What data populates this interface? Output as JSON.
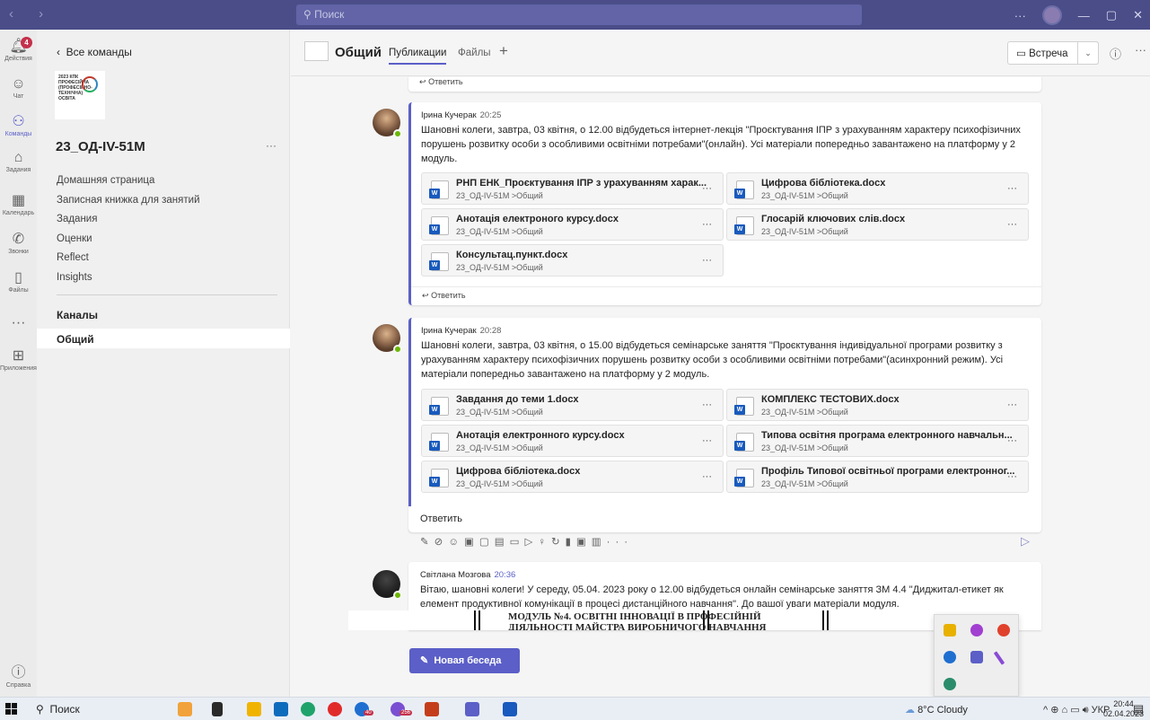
{
  "topbar": {
    "search_placeholder": "Поиск",
    "ellipsis": "···"
  },
  "rail": [
    {
      "label": "Действия",
      "badge": "4"
    },
    {
      "label": "Чат"
    },
    {
      "label": "Команды"
    },
    {
      "label": "Задания"
    },
    {
      "label": "Календарь"
    },
    {
      "label": "Звонки"
    },
    {
      "label": "Файлы"
    },
    {
      "label": "Приложения"
    },
    {
      "label": "Справка"
    }
  ],
  "panel": {
    "back": "Все команды",
    "logo_text": "2023 КПК ПРОФЕСІЙНА (ПРОФЕСІЙНО-ТЕХНІЧНА) ОСВІТА",
    "team_name": "23_ОД-IV-51М",
    "more": "···",
    "links": [
      "Домашняя страница",
      "Записная книжка для занятий",
      "Задания",
      "Оценки",
      "Reflect",
      "Insights"
    ],
    "channels_header": "Каналы",
    "channel": "Общий"
  },
  "header": {
    "title": "Общий",
    "tab_posts": "Публикации",
    "tab_files": "Файлы",
    "add": "+",
    "meet": "Встреча",
    "more": "···"
  },
  "posts": [
    {
      "reply": "Ответить"
    },
    {
      "author": "Ірина Кучерак",
      "time": "20:25",
      "text": "Шановні колеги, завтра, 03 квітня, о 12.00 відбудеться інтернет-лекція \"Проєктування ІПР з урахуванням характеру психофізичних порушень розвитку особи з особливими освітніми потребами\"(онлайн). Усі матеріали попередньо завантажено на платформу у 2 модуль.",
      "files": [
        {
          "name": "РНП ЕНК_Проєктування ІПР з урахуванням харак...",
          "path": "23_ОД-IV-51М >Общий"
        },
        {
          "name": "Цифрова бібліотека.docx",
          "path": "23_ОД-IV-51М >Общий"
        },
        {
          "name": "Анотація електроного курсу.docx",
          "path": "23_ОД-IV-51М >Общий"
        },
        {
          "name": "Глосарій ключових слів.docx",
          "path": "23_ОД-IV-51М >Общий"
        },
        {
          "name": "Консультац.пункт.docx",
          "path": "23_ОД-IV-51М >Общий"
        }
      ],
      "reply": "Ответить"
    },
    {
      "author": "Ірина Кучерак",
      "time": "20:28",
      "text": "Шановні колеги, завтра, 03 квітня, о 15.00 відбудеться семінарське заняття \"Проєктування індивідуальної програми розвитку з урахуванням характеру психофізичних порушень розвитку особи з особливими освітніми потребами\"(асинхронний режим). Усі матеріали попередньо завантажено на платформу у 2 модуль.",
      "files": [
        {
          "name": "Завдання до теми 1.docx",
          "path": "23_ОД-IV-51М >Общий"
        },
        {
          "name": "КОМПЛЕКС ТЕСТОВИХ.docx",
          "path": "23_ОД-IV-51М >Общий"
        },
        {
          "name": "Анотація електронного курсу.docx",
          "path": "23_ОД-IV-51М >Общий"
        },
        {
          "name": "Типова освітня програма електронного навчальн...",
          "path": "23_ОД-IV-51М >Общий"
        },
        {
          "name": "Цифрова бібліотека.docx",
          "path": "23_ОД-IV-51М >Общий"
        },
        {
          "name": "Профіль Типової освітньої програми електронног...",
          "path": "23_ОД-IV-51М >Общий"
        }
      ],
      "composer": "Ответить"
    },
    {
      "author": "Світлана Мозгова",
      "time": "20:36",
      "text": "Вітаю, шановні колеги! У середу, 05.04. 2023 року о 12.00 відбудеться онлайн семінарське заняття ЗМ 4.4 \"Диджитал-етикет як елемент продуктивної комунікації в процесі дистанційного навчання\". До вашої уваги матеріали модуля.",
      "doc_line1": "МОДУЛЬ №4. ОСВІТНІ ІННОВАЦІЇ В ПРОФЕСІЙНІЙ",
      "doc_line2": "ДІЯЛЬНОСТІ МАЙСТРА ВИРОБНИЧОГО НАВЧАННЯ"
    }
  ],
  "new_conversation": "Новая беседа",
  "taskbar": {
    "search": "Поиск",
    "weather": "8°C Cloudy",
    "lang": "УКР",
    "time": "20:44",
    "date": "02.04.2023",
    "badge_a": "40",
    "badge_b": "256"
  },
  "colors": {
    "accent": "#5b5fc7",
    "titlebar": "#4a4d88",
    "online": "#6bb700",
    "word": "#185abd"
  }
}
